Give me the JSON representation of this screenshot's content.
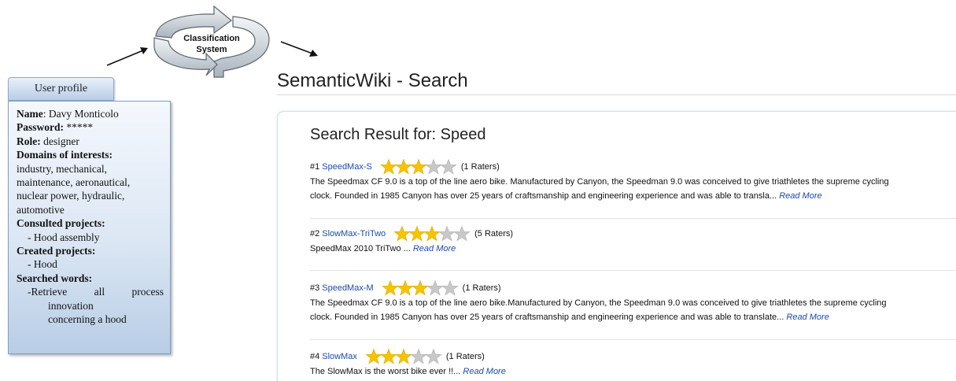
{
  "classification": {
    "label": "Classification System"
  },
  "profile": {
    "tab_label": "User profile",
    "name_label": "Name",
    "name_value": "Davy Monticolo",
    "password_label": "Password:",
    "password_value": "*****",
    "role_label": "Role:",
    "role_value": "designer",
    "domains_label": "Domains of interests:",
    "domains_lines": [
      "industry, mechanical,",
      "maintenance, aeronautical,",
      "nuclear power, hydraulic,",
      "automotive"
    ],
    "consulted_label": "Consulted projects:",
    "consulted_item": "- Hood assembly",
    "created_label": "Created projects:",
    "created_item": "- Hood",
    "searched_label": "Searched words:",
    "searched_word1": "-Retrieve",
    "searched_word2": "all",
    "searched_word3": "process",
    "searched_line2": "innovation",
    "searched_line3": "concerning a hood"
  },
  "wiki": {
    "title": "SemanticWiki - Search",
    "result_heading": "Search Result for: Speed",
    "read_more": "Read More",
    "results": [
      {
        "rank": "#1",
        "name": "SpeedMax-S",
        "rating": 3,
        "raters": "(1 Raters)",
        "lines": [
          "The Speedmax CF 9.0 is a top of the line aero bike. Manufactured by Canyon, the Speedman 9.0 was conceived to give triathletes the supreme cycling",
          "clock. Founded in 1985 Canyon has over 25 years of craftsmanship and engineering experience and was able to transla..."
        ]
      },
      {
        "rank": "#2",
        "name": "SlowMax-TriTwo",
        "rating": 3,
        "raters": "(5 Raters)",
        "lines": [
          "SpeedMax 2010 TriTwo ..."
        ]
      },
      {
        "rank": "#3",
        "name": "SpeedMax-M",
        "rating": 3,
        "raters": "(1 Raters)",
        "lines": [
          "The Speedmax CF 9.0 is a top of the line aero bike.Manufactured by Canyon, the Speedman 9.0 was conceived to give triathletes the supreme cycling",
          "clock. Founded in 1985 Canyon has over 25 years of craftsmanship and engineering experience and was able to translate..."
        ]
      },
      {
        "rank": "#4",
        "name": "SlowMax",
        "rating": 3,
        "raters": "(1 Raters)",
        "lines": [
          "The SlowMax is the worst bike ever !!..."
        ]
      }
    ]
  },
  "colors": {
    "link": "#1a4bb0",
    "star_on": "#f5c400",
    "star_off": "#c8c8c8",
    "profile_border": "#7f9ec8"
  }
}
